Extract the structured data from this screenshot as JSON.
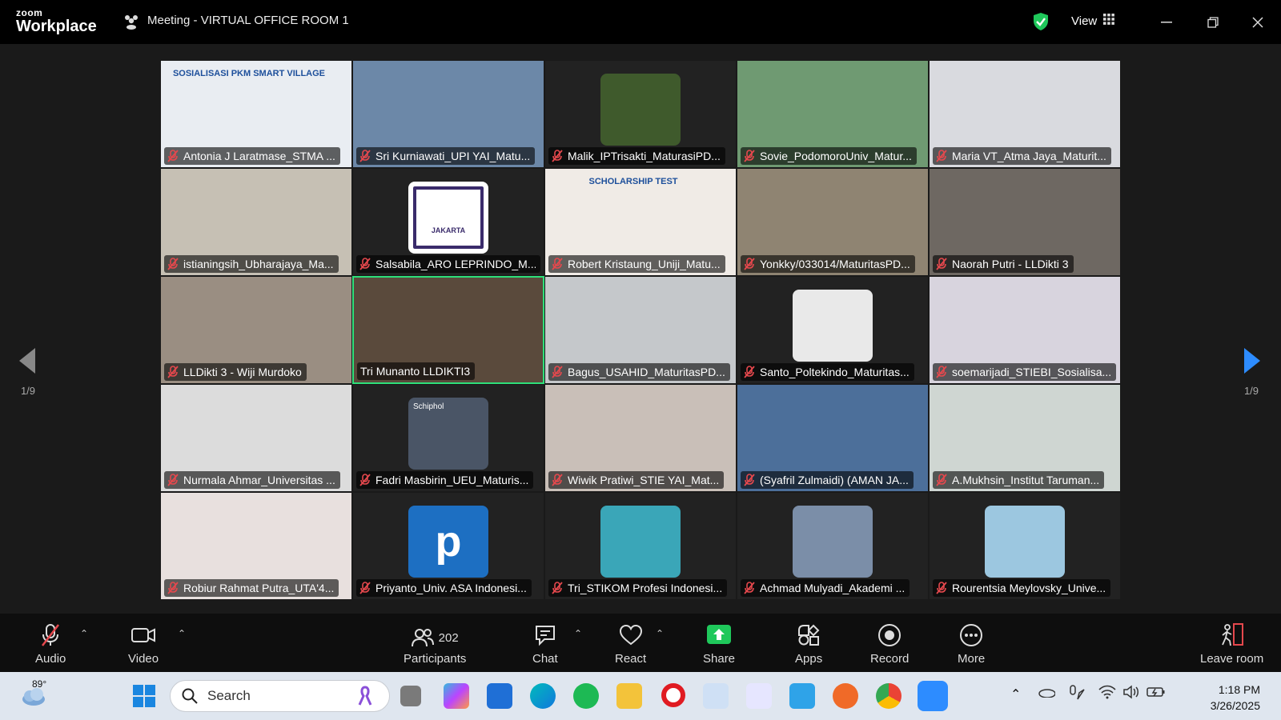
{
  "titlebar": {
    "brand_small": "zoom",
    "brand_big": "Workplace",
    "meeting_title": "Meeting - VIRTUAL OFFICE ROOM 1",
    "view_label": "View"
  },
  "tiles": [
    {
      "name": "Antonia J Laratmase_STMA ...",
      "bg": "#e9edf2",
      "caption": "SOSIALISASI PKM SMART VILLAGE"
    },
    {
      "name": "Sri Kurniawati_UPI YAI_Matu...",
      "bg": "#6c88a8"
    },
    {
      "name": "Malik_IPTrisakti_MaturasiPD...",
      "bg": "#222",
      "pic": "#3f5a2c"
    },
    {
      "name": "Sovie_PodomoroUniv_Matur...",
      "bg": "#6f9a72"
    },
    {
      "name": "Maria VT_Atma Jaya_Maturit...",
      "bg": "#d9dadf"
    },
    {
      "name": "istianingsih_Ubharajaya_Ma...",
      "bg": "#c6c0b4"
    },
    {
      "name": "Salsabila_ARO LEPRINDO_M...",
      "bg": "#222",
      "pic": "#ffffff",
      "badge": "JAKARTA"
    },
    {
      "name": "Robert Kristaung_Uniji_Matu...",
      "bg": "#f0ebe6",
      "caption": "SCHOLARSHIP TEST"
    },
    {
      "name": "Yonkky/033014/MaturitasPD...",
      "bg": "#8f8472"
    },
    {
      "name": "Naorah Putri - LLDikti 3",
      "bg": "#6e6862"
    },
    {
      "name": "LLDikti 3 - Wiji Murdoko",
      "bg": "#9a8e82"
    },
    {
      "name": "Tri Munanto LLDIKTI3",
      "bg": "#5a4a3c",
      "active": true
    },
    {
      "name": "Bagus_USAHID_MaturitasPD...",
      "bg": "#c5c8cb"
    },
    {
      "name": "Santo_Poltekindo_Maturitas...",
      "bg": "#222",
      "pic": "#e9e9e9"
    },
    {
      "name": "soemarijadi_STIEBI_Sosialisa...",
      "bg": "#d8d4de"
    },
    {
      "name": "Nurmala Ahmar_Universitas ...",
      "bg": "#dcdcdc"
    },
    {
      "name": "Fadri Masbirin_UEU_Maturis...",
      "bg": "#222",
      "pic": "#4a5566",
      "caption": "Schiphol"
    },
    {
      "name": "Wiwik Pratiwi_STIE YAI_Mat...",
      "bg": "#c9bfb8"
    },
    {
      "name": "(Syafril Zulmaidi) (AMAN JA...",
      "bg": "#4c6f9a"
    },
    {
      "name": "A.Mukhsin_Institut Taruman...",
      "bg": "#cfd6d2"
    },
    {
      "name": "Robiur Rahmat Putra_UTA'4...",
      "bg": "#e8e0de"
    },
    {
      "name": "Priyanto_Univ. ASA Indonesi...",
      "bg": "#222",
      "pic": "#1d6fc2",
      "letter": "p"
    },
    {
      "name": "Tri_STIKOM Profesi Indonesi...",
      "bg": "#222",
      "pic": "#3aa6b8"
    },
    {
      "name": "Achmad Mulyadi_Akademi ...",
      "bg": "#222",
      "pic": "#7b8ea8"
    },
    {
      "name": "Rourentsia Meylovsky_Unive...",
      "bg": "#222",
      "pic": "#9cc7e0"
    }
  ],
  "pager": {
    "left": "1/9",
    "right": "1/9"
  },
  "toolbar": {
    "audio": "Audio",
    "video": "Video",
    "participants": "Participants",
    "participants_count": "202",
    "chat": "Chat",
    "react": "React",
    "share": "Share",
    "apps": "Apps",
    "record": "Record",
    "more": "More",
    "leave": "Leave room"
  },
  "taskbar": {
    "temperature": "89°",
    "search_placeholder": "Search",
    "time": "1:18 PM",
    "date": "3/26/2025"
  },
  "colors": {
    "accent_green": "#2ee07a",
    "share_green": "#1fc85b",
    "mic_red": "#e5484d",
    "pager_blue": "#2d8cff"
  }
}
